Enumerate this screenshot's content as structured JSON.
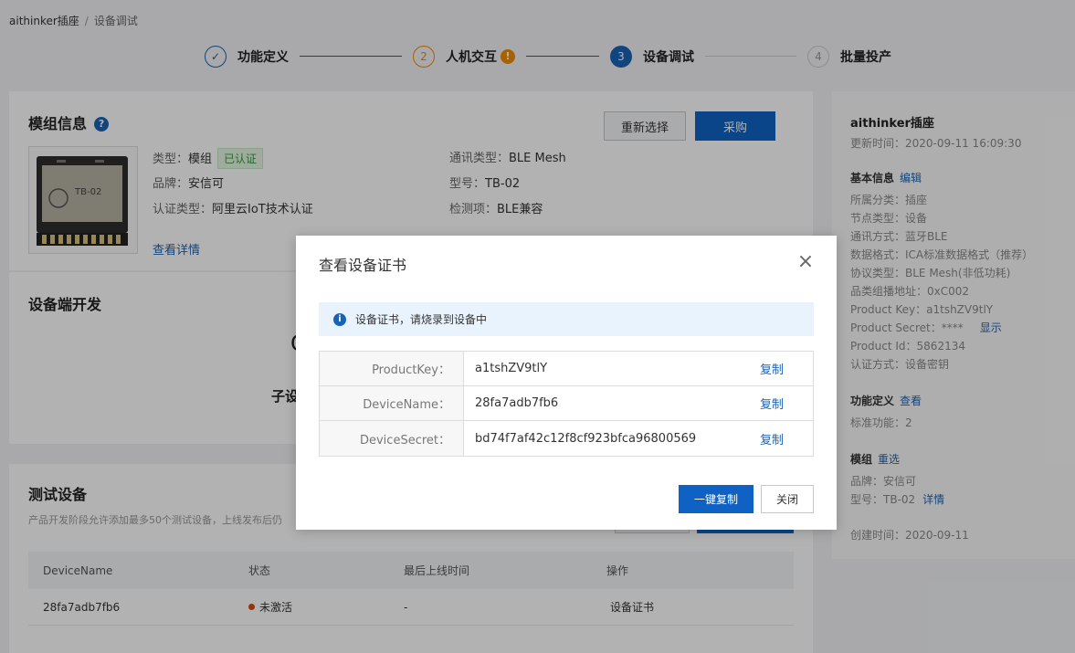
{
  "breadcrumb": {
    "root": "aithinker插座",
    "sep": "/",
    "current": "设备调试"
  },
  "stepper": [
    {
      "num": "✓",
      "label": "功能定义",
      "state": "done"
    },
    {
      "num": "2",
      "label": "人机交互",
      "state": "warn",
      "warn_icon": "!"
    },
    {
      "num": "3",
      "label": "设备调试",
      "state": "active"
    },
    {
      "num": "4",
      "label": "批量投产",
      "state": "todo"
    }
  ],
  "module": {
    "title": "模组信息",
    "help_icon": "?",
    "reselect_label": "重新选择",
    "buy_label": "采购",
    "type_label": "类型：",
    "type_value": "模组",
    "cert_badge": "已认证",
    "brand_label": "品牌：",
    "brand_value": "安信可",
    "cert_type_label": "认证类型：",
    "cert_type_value": "阿里云IoT技术认证",
    "comm_label": "通讯类型：",
    "comm_value": "BLE Mesh",
    "model_label": "型号：",
    "model_value": "TB-02",
    "check_label": "检测项：",
    "check_value": "BLE兼容",
    "detail_link": "查看详情",
    "chip_text": "TB-02"
  },
  "device_dev": {
    "title": "设备端开发",
    "peek_c": "C",
    "peek_sub": "子设"
  },
  "test_devices": {
    "title": "测试设备",
    "desc": "产品开发阶段允许添加最多50个测试设备，上线发布后仍",
    "columns": [
      "DeviceName",
      "状态",
      "最后上线时间",
      "操作"
    ],
    "rows": [
      {
        "name": "28fa7adb7fb6",
        "status": "未激活",
        "last_online": "-",
        "action": "设备证书"
      }
    ]
  },
  "right_panel": {
    "product_name": "aithinker插座",
    "updated": "更新时间：2020-09-11 16:09:30",
    "basic_title": "基本信息",
    "basic_edit": "编辑",
    "basic_lines": [
      "所属分类：插座",
      "节点类型：设备",
      "通讯方式：蓝牙BLE",
      "数据格式：ICA标准数据格式（推荐）",
      "协议类型：BLE Mesh(非低功耗)",
      "品类组播地址：0xC002",
      "Product Key：a1tshZV9tlY",
      "Product Secret：****",
      "Product Id：5862134",
      "认证方式：设备密钥"
    ],
    "show_link": "显示",
    "func_title": "功能定义",
    "func_link": "查看",
    "func_line": "标准功能：2",
    "module_title": "模组",
    "module_link": "重选",
    "module_brand": "品牌：安信可",
    "module_model": "型号：TB-02",
    "module_detail": "详情",
    "created": "创建时间：2020-09-11"
  },
  "dialog": {
    "title": "查看设备证书",
    "close_icon": "×",
    "notice_icon": "i",
    "notice": "设备证书，请烧录到设备中",
    "rows": [
      {
        "key": "ProductKey：",
        "value": "a1tshZV9tlY",
        "copy": "复制"
      },
      {
        "key": "DeviceName：",
        "value": "28fa7adb7fb6",
        "copy": "复制"
      },
      {
        "key": "DeviceSecret：",
        "value": "bd74f7af42c12f8cf923bfca96800569",
        "copy": "复制"
      }
    ],
    "copy_all_label": "一键复制",
    "close_label": "关闭"
  },
  "colors": {
    "primary": "#0f62c4",
    "link": "#1a63b4",
    "step_done": "#1a63b4",
    "step_warn": "#f08c00",
    "status_inactive": "#d9480f"
  }
}
